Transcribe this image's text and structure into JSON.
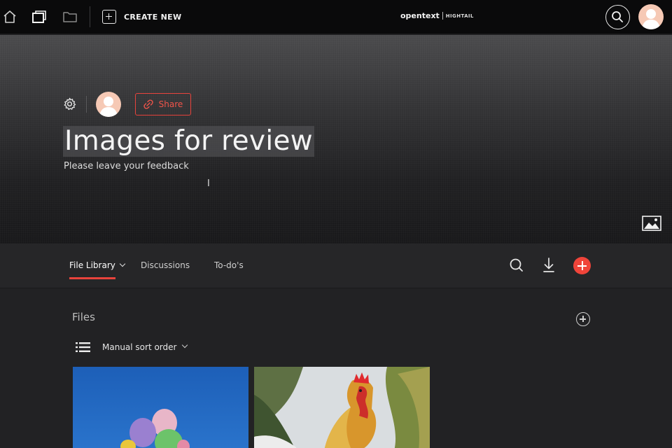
{
  "topbar": {
    "create_new_label": "CREATE NEW",
    "brand_main": "opentext",
    "brand_sub": "HIGHTAIL",
    "icons": [
      "home-icon",
      "windows-icon",
      "folder-icon",
      "search-icon",
      "avatar"
    ]
  },
  "hero": {
    "title": "Images for review",
    "subtitle": "Please leave your feedback",
    "share_label": "Share"
  },
  "tabs": [
    {
      "label": "File Library",
      "active": true
    },
    {
      "label": "Discussions",
      "active": false
    },
    {
      "label": "To-do's",
      "active": false
    }
  ],
  "files": {
    "heading": "Files",
    "sort_label": "Manual sort order",
    "thumbnails": [
      "balloons-image",
      "rooster-image"
    ]
  },
  "colors": {
    "accent": "#e8433c",
    "topbar_bg": "#0a0a0b",
    "panel_bg": "#222224"
  }
}
